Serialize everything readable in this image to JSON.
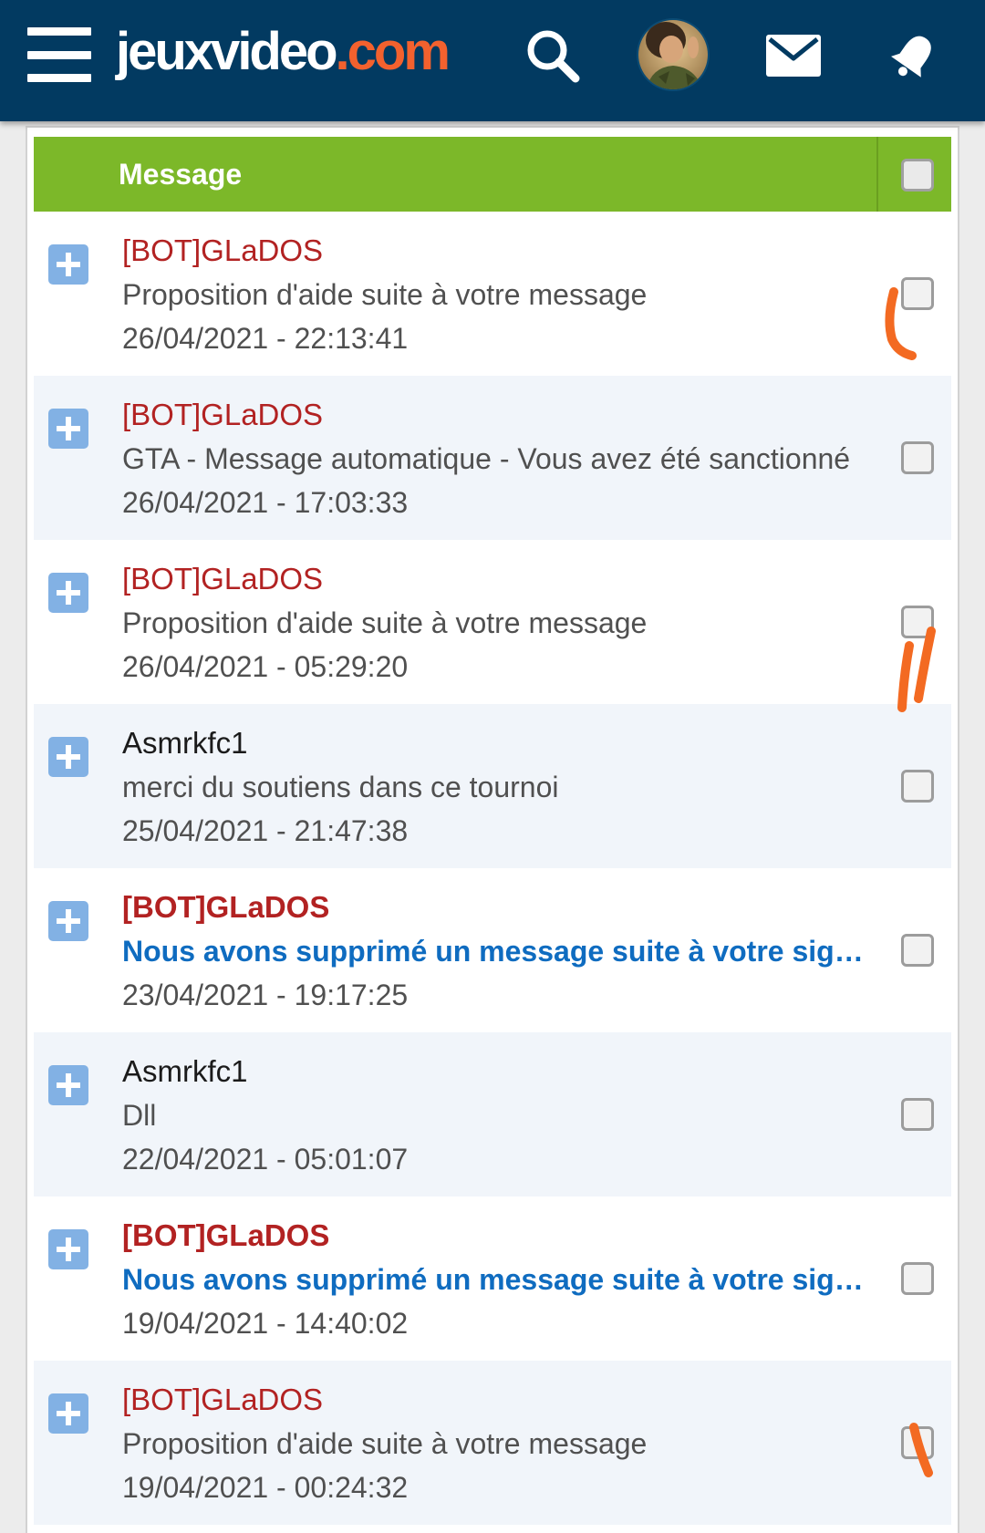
{
  "header": {
    "logo_main": "jeuxvideo",
    "logo_dot": ".",
    "logo_tld": "com",
    "colors": {
      "bar": "#023a61",
      "accent": "#f3612e"
    }
  },
  "icons": {
    "menu": "hamburger-menu-icon",
    "search": "search-icon",
    "mail": "envelope-icon",
    "notifications": "bell-icon"
  },
  "table": {
    "column_title": "Message",
    "header_color": "#7cb829",
    "rows": [
      {
        "author": "[BOT]GLaDOS",
        "subject": "Proposition d'aide suite à votre message",
        "date": "26/04/2021 - 22:13:41"
      },
      {
        "author": "[BOT]GLaDOS",
        "subject": "GTA - Message automatique - Vous avez été sanctionné",
        "date": "26/04/2021 - 17:03:33"
      },
      {
        "author": "[BOT]GLaDOS",
        "subject": "Proposition d'aide suite à votre message",
        "date": "26/04/2021 - 05:29:20"
      },
      {
        "author": "Asmrkfc1",
        "subject": "merci du soutiens dans ce tournoi",
        "date": "25/04/2021 - 21:47:38"
      },
      {
        "author": "[BOT]GLaDOS",
        "subject": "Nous avons supprimé un message suite à votre signalement",
        "date": "23/04/2021 - 19:17:25"
      },
      {
        "author": "Asmrkfc1",
        "subject": "Dll",
        "date": "22/04/2021 - 05:01:07"
      },
      {
        "author": "[BOT]GLaDOS",
        "subject": "Nous avons supprimé un message suite à votre signalement",
        "date": "19/04/2021 - 14:40:02"
      },
      {
        "author": "[BOT]GLaDOS",
        "subject": "Proposition d'aide suite à votre message",
        "date": "19/04/2021 - 00:24:32"
      }
    ]
  }
}
